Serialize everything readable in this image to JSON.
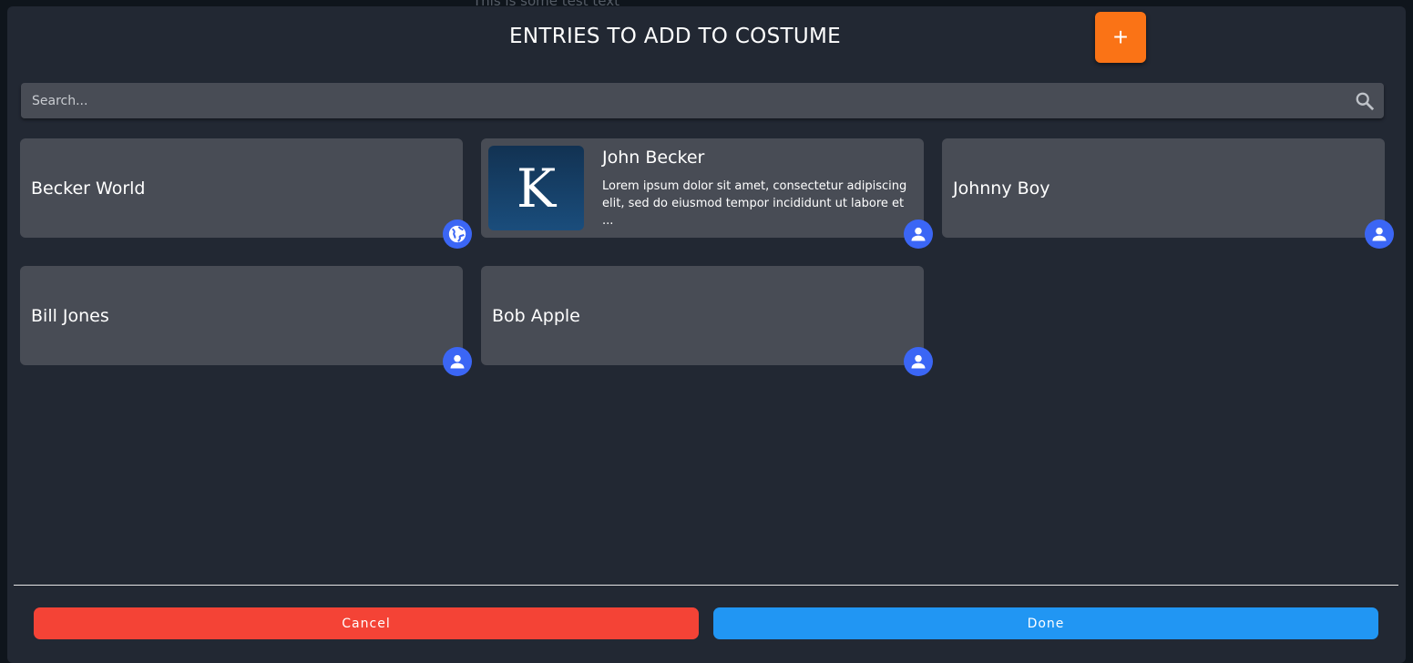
{
  "background": {
    "text": "This is some test text"
  },
  "modal": {
    "title": "ENTRIES TO ADD TO COSTUME",
    "add_label": "+",
    "search": {
      "placeholder": "Search...",
      "value": ""
    },
    "cards": [
      {
        "name": "Becker World",
        "type": "globe-icon"
      },
      {
        "name": "John Becker",
        "type": "person-icon",
        "thumb_letter": "K",
        "description": "Lorem ipsum dolor sit amet, consectetur adipiscing elit, sed do eiusmod tempor incididunt ut labore et ..."
      },
      {
        "name": "Johnny Boy",
        "type": "person-icon"
      },
      {
        "name": "Bill Jones",
        "type": "person-icon"
      },
      {
        "name": "Bob Apple",
        "type": "person-icon"
      }
    ],
    "cancel_label": "Cancel",
    "done_label": "Done"
  },
  "colors": {
    "accent_add": "#fa7316",
    "cancel": "#f44336",
    "done": "#2196f3",
    "badge": "#3b66f5"
  }
}
